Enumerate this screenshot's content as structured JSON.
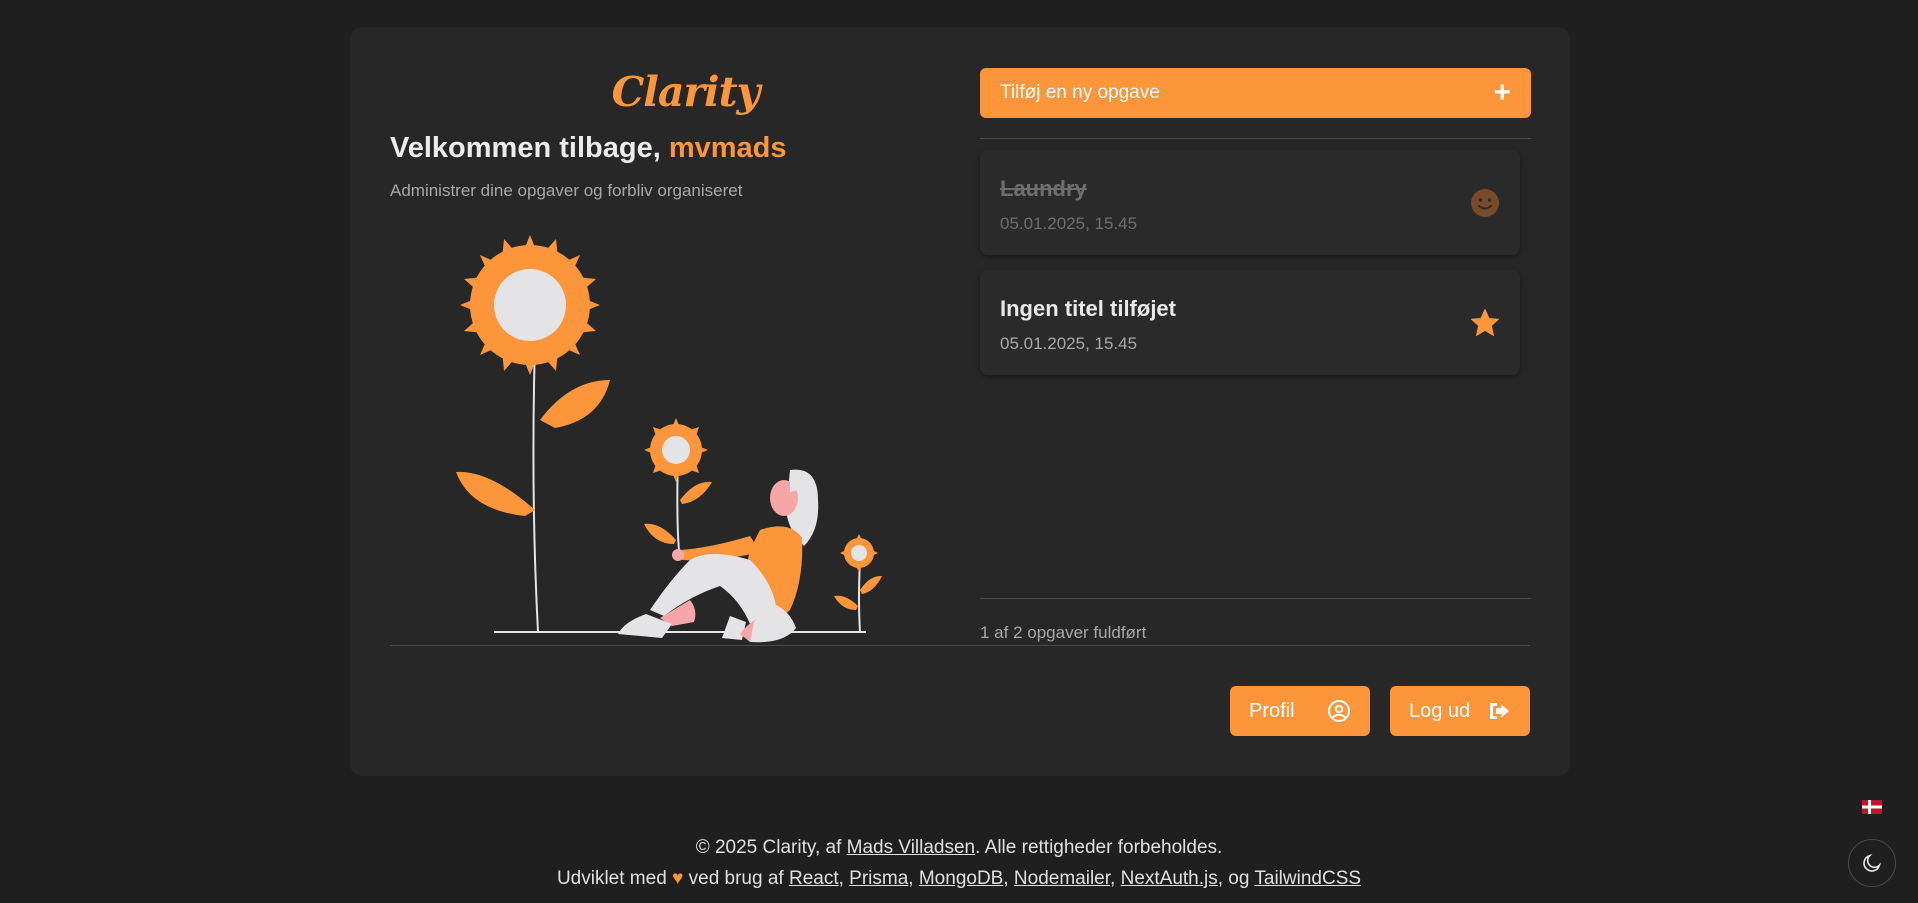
{
  "app": {
    "logo": "Clarity"
  },
  "welcome": {
    "prefix": "Velkommen tilbage, ",
    "username": "mvmads",
    "subtitle": "Administrer dine opgaver og forbliv organiseret"
  },
  "add_task": {
    "label": "Tilføj en ny opgave",
    "icon": "plus-icon"
  },
  "tasks": [
    {
      "title": "Laundry",
      "date": "05.01.2025, 15.45",
      "completed": true,
      "icon": "smiley-icon"
    },
    {
      "title": "Ingen titel tilføjet",
      "date": "05.01.2025, 15.45",
      "completed": false,
      "icon": "star-icon"
    }
  ],
  "progress": "1 af 2 opgaver fuldført",
  "buttons": {
    "profile": "Profil",
    "logout": "Log ud"
  },
  "footer": {
    "copyright": "© 2025 Clarity, af ",
    "author": "Mads Villadsen",
    "rights": ". Alle rettigheder forbeholdes.",
    "dev_prefix": "Udviklet med ",
    "heart": "♥",
    "dev_middle": " ved brug af ",
    "links": [
      "React",
      "Prisma",
      "MongoDB",
      "Nodemailer",
      "NextAuth.js",
      "TailwindCSS"
    ],
    "sep": ", ",
    "og": ", og "
  },
  "colors": {
    "accent": "#fd963a",
    "background": "#1f1f1f",
    "card": "#272727"
  }
}
